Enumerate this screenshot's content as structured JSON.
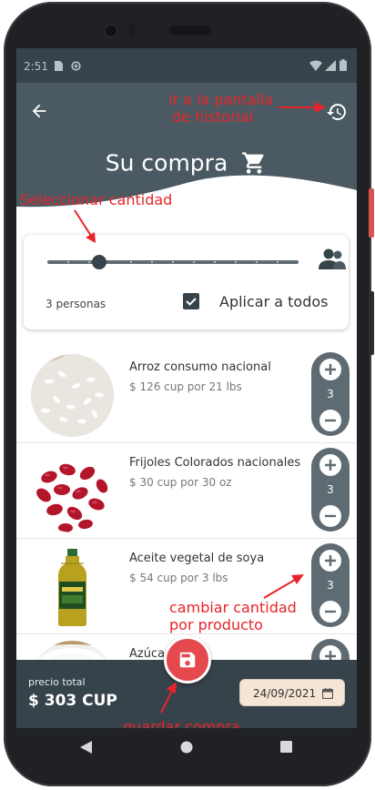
{
  "status_bar": {
    "time": "2:51"
  },
  "header": {
    "title": "Su compra",
    "back_icon": "arrow-left-icon",
    "history_icon": "history-clock-icon",
    "cart_icon": "shopping-cart-icon",
    "background_color": "#4b5a62"
  },
  "controls": {
    "slider_value_people": 3,
    "people_label": "3 personas",
    "apply_all_label": "Aplicar a todos",
    "apply_all_checked": true,
    "people_icon": "people-icon"
  },
  "products": [
    {
      "name": "Arroz consumo nacional",
      "price": "$ 126 cup por 21 lbs",
      "qty": "3",
      "image_icon": "rice-image"
    },
    {
      "name": "Frijoles Colorados nacionales",
      "price": "$ 30 cup por 30 oz",
      "qty": "3",
      "image_icon": "red-beans-image"
    },
    {
      "name": "Aceite vegetal de soya",
      "price": "$ 54 cup por 3 lbs",
      "qty": "3",
      "image_icon": "oil-bottle-image"
    },
    {
      "name": "Azúcar",
      "price": "",
      "qty": "",
      "image_icon": "sugar-image"
    }
  ],
  "bottom_bar": {
    "total_label": "precio total",
    "total_value": "$ 303 CUP",
    "date": "24/09/2021",
    "date_icon": "calendar-icon",
    "save_icon": "save-icon"
  },
  "annotations": {
    "history": "ir a la pantalla\nde historial",
    "select_qty": "Seleccionar cantidad",
    "change_qty": "cambiar cantidad\npor producto",
    "save": "guardar compra"
  },
  "colors": {
    "primary": "#37434b",
    "accent": "#e5484d",
    "annotation": "#e8242a",
    "date_chip": "#f4e5d5"
  }
}
